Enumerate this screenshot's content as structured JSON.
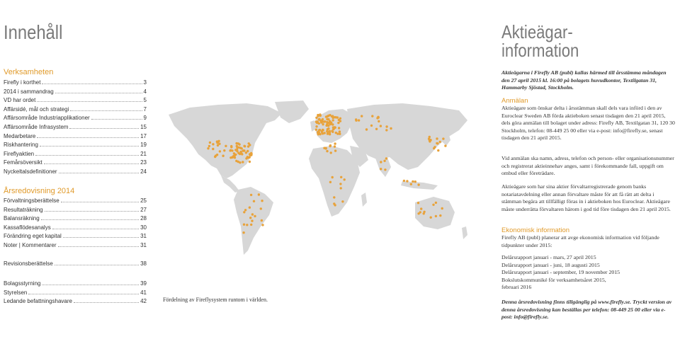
{
  "left": {
    "title": "Innehåll",
    "sec1": "Verksamheten",
    "items1": [
      {
        "label": "Firefly i korthet",
        "page": "3"
      },
      {
        "label": "2014 i sammandrag",
        "page": "4"
      },
      {
        "label": "VD har ordet",
        "page": "5"
      },
      {
        "label": "Affärsidé, mål och strategi",
        "page": "7"
      },
      {
        "label": "Affärsområde Industriapplikationer",
        "page": "9"
      },
      {
        "label": "Affärsområde Infrasystem",
        "page": "15"
      },
      {
        "label": "Medarbetare",
        "page": "17"
      },
      {
        "label": "Riskhantering",
        "page": "19"
      },
      {
        "label": "Fireflyaktien",
        "page": "21"
      },
      {
        "label": "Femårsöversikt",
        "page": "23"
      },
      {
        "label": "Nyckeltalsdefinitioner",
        "page": "24"
      }
    ],
    "sec2": "Årsredovisning 2014",
    "items2": [
      {
        "label": "Förvaltningsberättelse",
        "page": "25"
      },
      {
        "label": "Resultaträkning",
        "page": "27"
      },
      {
        "label": "Balansräkning",
        "page": "28"
      },
      {
        "label": "Kassaflödesanalys",
        "page": "30"
      },
      {
        "label": "Förändring eget kapital",
        "page": "31"
      },
      {
        "label": "Noter | Kommentarer",
        "page": "31"
      }
    ],
    "items3": [
      {
        "label": "Revisionsberättelse",
        "page": "38"
      }
    ],
    "items4": [
      {
        "label": "Bolagsstyrning",
        "page": "39"
      },
      {
        "label": "Styrelsen",
        "page": "41"
      },
      {
        "label": "Ledande befattningshavare",
        "page": "42"
      }
    ]
  },
  "middle": {
    "caption": "Fördelning av Fireflysystem runtom i världen.",
    "dot_color": "#e8a23a",
    "land_color": "#d7d7d7"
  },
  "right": {
    "title_line1": "Aktieägar-",
    "title_line2": "information",
    "intro": "Aktieägarna i Firefly AB (publ) kallas härmed till årsstämma måndagen den 27 april 2015 kl. 16:00 på bolagets huvudkontor, Textilgatan 31, Hammarby Sjöstad, Stockholm.",
    "h_anmalan": "Anmälan",
    "p1": "Aktieägare som önskar delta i årsstämman skall dels vara införd i den av Euroclear Sweden AB förda aktieboken senast tisdagen den 21 april 2015, dels göra anmälan till bolaget under adress: Firefly AB, Textilgatan 31, 120 30 Stockholm, telefon: 08-449 25 00 eller via e-post: info@firefly.se, senast tisdagen den 21 april 2015.",
    "p2": "Vid anmälan ska namn, adress, telefon och person- eller organisationsnummer och registrerat aktieinnehav anges, samt i förekommande fall, uppgift om ombud eller företrädare.",
    "p3": "Aktieägare som har sina aktier förvaltarregistrerade genom banks notariatavdelning eller annan förvaltare måste för att få rätt att delta i stämman begära att tillfälligt föras in i aktieboken hos Euroclear. Aktieägare måste underrätta förvaltaren härom i god tid före tisdagen den 21 april 2015.",
    "h_ekon": "Ekonomisk information",
    "p4": "Firefly AB (publ) planerar att avge ekonomisk information vid följande tidpunkter under 2015:",
    "dates": [
      "Delårsrapport januari - mars, 27 april 2015",
      "Delårsrapport januari - juni, 18 augusti 2015",
      "Delårsrapport januari - september, 19 november 2015",
      "Bokslutskommuniké för verksamhetsåret 2015,",
      "februari 2016"
    ],
    "closing": "Denna årsredovisning finns tillgänglig på www.firefly.se. Tryckt version av denna årsredovisning kan beställas per telefon: 08-449 25 00 eller via e-post: info@firefly.se."
  }
}
